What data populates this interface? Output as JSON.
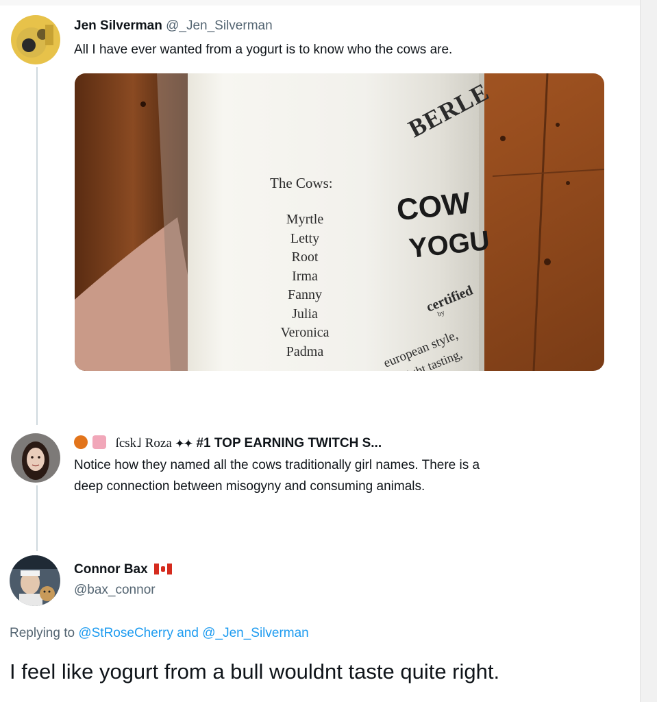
{
  "tweet1": {
    "name": "Jen Silverman",
    "handle": "@_Jen_Silverman",
    "text": "All I have ever wanted from a yogurt is to know who the cows are."
  },
  "image": {
    "brand": "BERLE",
    "product_line1": "COW",
    "product_line2": "YOGU",
    "certified": "certified",
    "byline": "by",
    "desc1": "european style,",
    "desc2": "light tasting,",
    "cows_heading": "The Cows:",
    "cows": [
      "Myrtle",
      "Letty",
      "Root",
      "Irma",
      "Fanny",
      "Julia",
      "Veronica",
      "Padma"
    ]
  },
  "tweet2": {
    "tag": "ſcsk˩",
    "name": "Roza",
    "name_rest": "#1 TOP EARNING TWITCH S...",
    "text_line1": "Notice how they named all the cows traditionally girl names. There is a",
    "text_line2": "deep connection between misogyny and consuming animals."
  },
  "tweet3": {
    "name": "Connor Bax",
    "handle": "@bax_connor",
    "replying_prefix": "Replying to",
    "reply_to1": "@StRoseCherry",
    "reply_and": "and",
    "reply_to2": "@_Jen_Silverman",
    "text": "I feel like yogurt from a bull wouldnt taste quite right."
  },
  "colors": {
    "link": "#1d9bf0",
    "handle": "#536471",
    "thread_line": "#cfd9de"
  },
  "icons": {
    "flag": "canada-flag-icon",
    "emoji1": "pumpkin-emoji-icon",
    "emoji2": "cake-emoji-icon"
  }
}
